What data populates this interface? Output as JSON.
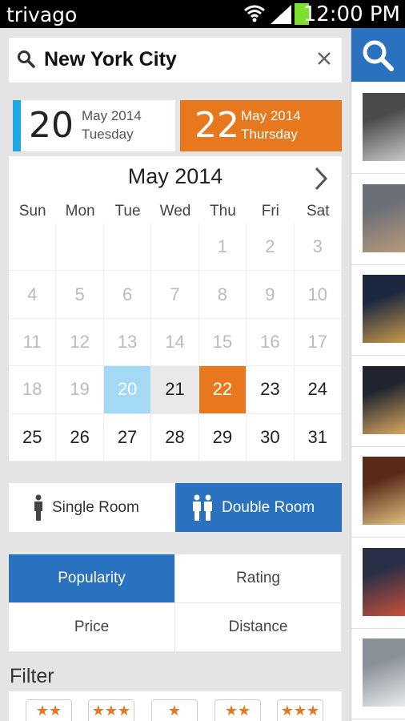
{
  "status_bar": {
    "app_name": "trivago",
    "time": "12:00 PM"
  },
  "search": {
    "query": "New York City"
  },
  "checkin": {
    "day": "20",
    "month": "May 2014",
    "weekday": "Tuesday"
  },
  "checkout": {
    "day": "22",
    "month": "May 2014",
    "weekday": "Thursday"
  },
  "calendar": {
    "title": "May 2014",
    "weekdays": [
      "Sun",
      "Mon",
      "Tue",
      "Wed",
      "Thu",
      "Fri",
      "Sat"
    ],
    "days": [
      "",
      "",
      "",
      "",
      "1",
      "2",
      "3",
      "4",
      "5",
      "6",
      "7",
      "8",
      "9",
      "10",
      "11",
      "12",
      "13",
      "14",
      "15",
      "16",
      "17",
      "18",
      "19",
      "20",
      "21",
      "22",
      "23",
      "24",
      "25",
      "26",
      "27",
      "28",
      "29",
      "30",
      "31"
    ],
    "checkin_day": "20",
    "checkout_day": "22"
  },
  "rooms": {
    "single_label": "Single Room",
    "double_label": "Double Room",
    "selected": "double"
  },
  "sort": {
    "popularity": "Popularity",
    "rating": "Rating",
    "price": "Price",
    "distance": "Distance",
    "selected": "popularity"
  },
  "filter": {
    "title": "Filter",
    "star_options": [
      2,
      3,
      1,
      2,
      3
    ]
  },
  "colors": {
    "accent_orange": "#e8781e",
    "accent_blue": "#2a72bf",
    "checkin_blue": "#1ea7e0"
  },
  "results": {
    "thumbnails": [
      "hotel-1",
      "hotel-2",
      "hotel-3",
      "hotel-4",
      "hotel-5",
      "hotel-6",
      "hotel-7"
    ]
  }
}
